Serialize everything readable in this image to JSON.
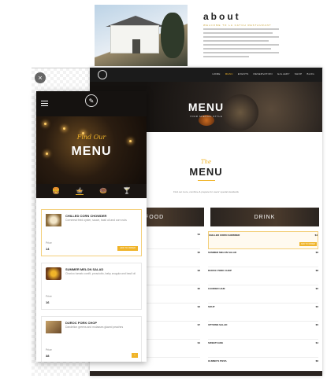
{
  "about": {
    "title": "about",
    "subtitle": "WELCOME TO LA CATCH RESTAURANT"
  },
  "desktop": {
    "nav": [
      "HOME",
      "MENU",
      "EVENTS",
      "RESERVATION",
      "GALLERY",
      "SHOP",
      "BLOG"
    ],
    "active_nav": 1,
    "hero_title": "MENU",
    "hero_tagline": "YOUR SPECIAL STYLE",
    "section_script": "The",
    "section_title": "MENU",
    "section_blurb": "Find out more, combine & prepare for users' special standards",
    "tabs": [
      "FOOD",
      "DRINK"
    ],
    "left_items": [
      {
        "name": "",
        "price": "$4"
      },
      {
        "name": "",
        "price": "$5"
      },
      {
        "name": "",
        "price": "$3"
      },
      {
        "name": "",
        "price": "$5"
      },
      {
        "name": "",
        "price": "$3"
      },
      {
        "name": "",
        "price": "$7"
      },
      {
        "name": "",
        "price": "$4"
      }
    ],
    "right_items": [
      {
        "name": "CHILLED CORN CHOWDER",
        "price": "$4",
        "badge": "ADD TO ORDER"
      },
      {
        "name": "SUMMER MELON SALAD",
        "price": "$6"
      },
      {
        "name": "DUROC PORK CHOP",
        "price": "$8"
      },
      {
        "name": "CANDIED HAM",
        "price": "$5"
      },
      {
        "name": "SOUP",
        "price": "$6"
      },
      {
        "name": "UPTOWN SALAD",
        "price": "$5"
      },
      {
        "name": "SWEETCAKE",
        "price": "$4"
      },
      {
        "name": "GUMBO'S PIZZA",
        "price": "$6"
      }
    ]
  },
  "mobile": {
    "find_label": "Find Our",
    "menu_label": "MENU",
    "categories": [
      "🍔",
      "🍲",
      "🍩",
      "🍸"
    ],
    "active_category": 1,
    "price_label": "Price",
    "items": [
      {
        "name": "CHILLED CORN CHOWDER",
        "desc": "Cornmeal fried oyster, sauce, basil oil and corn nuts",
        "price": "14",
        "action": "ADD TO ORDER"
      },
      {
        "name": "SUMMER MELON SALAD",
        "desc": "Chorizo tomato confit, prosciutto, baby arugula and basil oil",
        "price": "16",
        "action": ""
      },
      {
        "name": "DUROC PORK CHOP",
        "desc": "Dandelion greens and molasses glazed peaches",
        "price": "38",
        "action": "+"
      }
    ]
  }
}
